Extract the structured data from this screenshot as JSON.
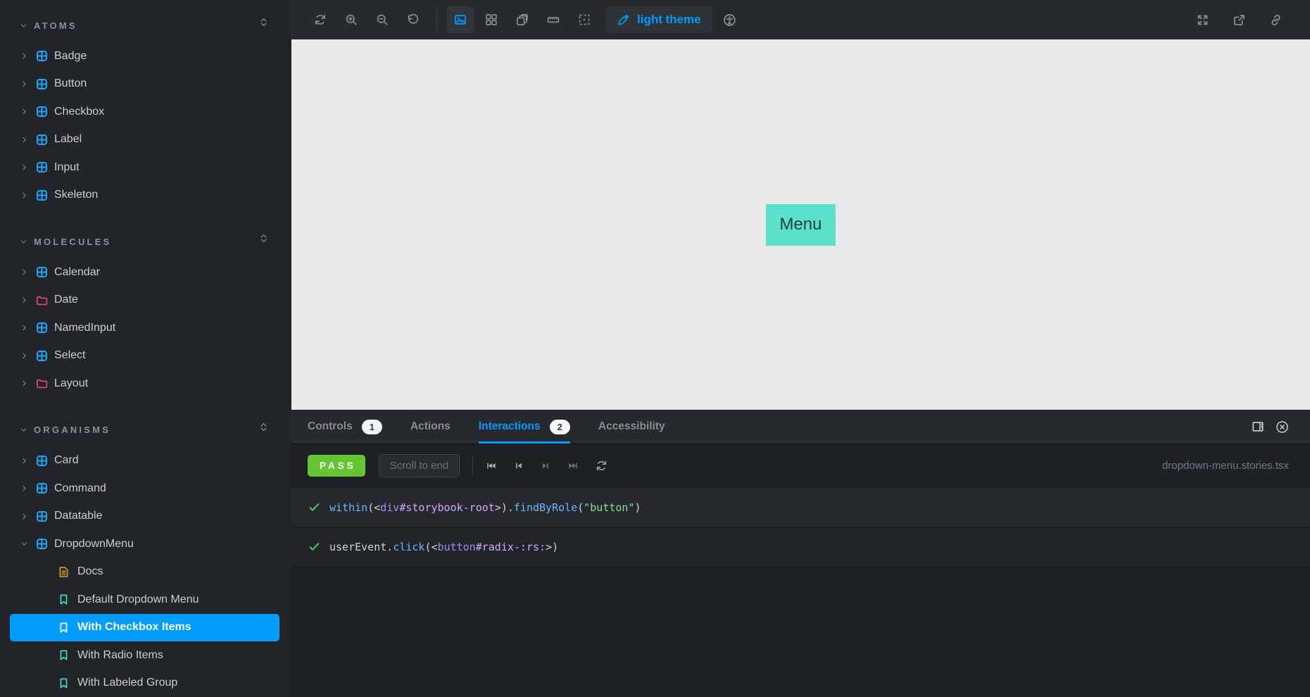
{
  "colors": {
    "accent": "#029cfd",
    "pass_green": "#67c433",
    "component_icon_blue": "#1ea7fd",
    "folder_icon_pink": "#e4447c",
    "docs_icon_orange": "#dfa324",
    "story_icon_teal": "#45d9c4",
    "canvas_bg": "#e8e8e8",
    "menu_button_bg": "#5be1c9",
    "menu_button_text": "#1d3e49",
    "code_plain": "#cdd3d8",
    "code_method": "#6cb6ff",
    "code_tag": "#a18cf5",
    "code_id": "#d2a8ff",
    "code_string": "#7ee787",
    "check_green": "#4ecb71"
  },
  "sidebar": {
    "sections": [
      {
        "label": "ATOMS",
        "items": [
          {
            "label": "Badge",
            "icon": "component"
          },
          {
            "label": "Button",
            "icon": "component"
          },
          {
            "label": "Checkbox",
            "icon": "component"
          },
          {
            "label": "Label",
            "icon": "component"
          },
          {
            "label": "Input",
            "icon": "component"
          },
          {
            "label": "Skeleton",
            "icon": "component"
          }
        ]
      },
      {
        "label": "MOLECULES",
        "items": [
          {
            "label": "Calendar",
            "icon": "component"
          },
          {
            "label": "Date",
            "icon": "folder"
          },
          {
            "label": "NamedInput",
            "icon": "component"
          },
          {
            "label": "Select",
            "icon": "component"
          },
          {
            "label": "Layout",
            "icon": "folder"
          }
        ]
      },
      {
        "label": "ORGANISMS",
        "items": [
          {
            "label": "Card",
            "icon": "component"
          },
          {
            "label": "Command",
            "icon": "component"
          },
          {
            "label": "Datatable",
            "icon": "component"
          },
          {
            "label": "DropdownMenu",
            "icon": "component",
            "expanded": true,
            "children": [
              {
                "label": "Docs",
                "icon": "document"
              },
              {
                "label": "Default Dropdown Menu",
                "icon": "bookmark"
              },
              {
                "label": "With Checkbox Items",
                "icon": "bookmark",
                "selected": true
              },
              {
                "label": "With Radio Items",
                "icon": "bookmark"
              },
              {
                "label": "With Labeled Group",
                "icon": "bookmark"
              }
            ]
          }
        ]
      }
    ]
  },
  "toolbar": {
    "left_icons": [
      {
        "icon": "remount",
        "name": "remount-icon"
      },
      {
        "icon": "zoom-in",
        "name": "zoom-in-icon"
      },
      {
        "icon": "zoom-out",
        "name": "zoom-out-icon"
      },
      {
        "icon": "reset-zoom",
        "name": "reset-zoom-icon"
      },
      {
        "divider": true
      },
      {
        "icon": "canvas-view",
        "name": "canvas-view-icon",
        "active": true
      },
      {
        "icon": "grid-view",
        "name": "grid-view-icon"
      },
      {
        "icon": "stacked-view",
        "name": "stacked-view-icon"
      },
      {
        "icon": "ruler",
        "name": "measure-icon"
      },
      {
        "icon": "outline",
        "name": "outline-icon"
      }
    ],
    "theme_button_label": "light theme",
    "right_icons": [
      {
        "icon": "fullscreen",
        "name": "fullscreen-icon"
      },
      {
        "icon": "open-external",
        "name": "open-external-icon"
      },
      {
        "icon": "link",
        "name": "copy-link-icon"
      }
    ]
  },
  "canvas": {
    "menu_button_label": "Menu"
  },
  "panel": {
    "tabs": [
      {
        "label": "Controls",
        "badge": "1"
      },
      {
        "label": "Actions"
      },
      {
        "label": "Interactions",
        "badge": "2",
        "active": true
      },
      {
        "label": "Accessibility"
      }
    ],
    "status_label": "PASS",
    "scroll_button_label": "Scroll to end",
    "playback_icons": [
      {
        "icon": "skip-to-start",
        "name": "skip-to-start-icon",
        "tone": "bright"
      },
      {
        "icon": "step-back",
        "name": "step-back-icon",
        "tone": "bright"
      },
      {
        "icon": "step-forward",
        "name": "step-forward-icon",
        "tone": "dim"
      },
      {
        "icon": "skip-to-end",
        "name": "skip-to-end-icon",
        "tone": "dim"
      },
      {
        "icon": "rerun",
        "name": "rerun-icon",
        "tone": ""
      }
    ],
    "file_name": "dropdown-menu.stories.tsx",
    "interactions": [
      {
        "segments": [
          [
            "within",
            "method"
          ],
          [
            "(<",
            "plain"
          ],
          [
            "div",
            "tag"
          ],
          [
            "#storybook-root",
            "id"
          ],
          [
            ">",
            "plain"
          ],
          [
            ").",
            "plain"
          ],
          [
            "findByRole",
            "method"
          ],
          [
            "(",
            "plain"
          ],
          [
            "\"button\"",
            "string"
          ],
          [
            ")",
            "plain"
          ]
        ]
      },
      {
        "segments": [
          [
            "userEvent",
            "plain"
          ],
          [
            ".",
            "plain"
          ],
          [
            "click",
            "method"
          ],
          [
            "(<",
            "plain"
          ],
          [
            "button",
            "tag"
          ],
          [
            "#radix-:rs:",
            "id"
          ],
          [
            ">)",
            "plain"
          ]
        ]
      }
    ]
  }
}
